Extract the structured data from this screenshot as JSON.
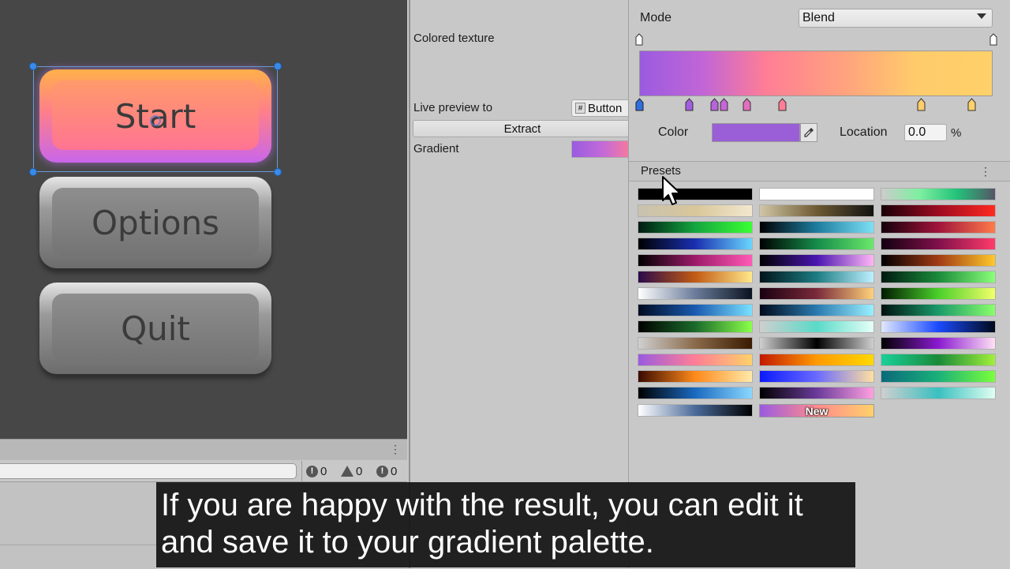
{
  "scene": {
    "buttons": {
      "start": "Start",
      "options": "Options",
      "quit": "Quit"
    }
  },
  "console": {
    "error_count": "0",
    "warning_count": "0",
    "info_count": "0"
  },
  "inspector": {
    "colored_texture_label": "Colored texture",
    "live_preview_label": "Live preview to",
    "live_preview_target": "Button",
    "extract_button": "Extract",
    "gradient_label": "Gradient"
  },
  "gradient_editor": {
    "mode_label": "Mode",
    "mode_value": "Blend",
    "color_label": "Color",
    "location_label": "Location",
    "location_value": "0.0",
    "location_unit": "%",
    "presets_label": "Presets",
    "new_preset_label": "New",
    "selected_color": "#9a5ed6"
  },
  "caption": {
    "line1": "If you are happy with the result, you can edit it",
    "line2": "and save it to your gradient palette."
  }
}
